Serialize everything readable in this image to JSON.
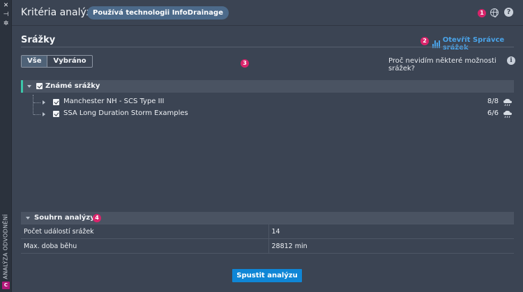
{
  "sidebar_strip": {
    "close_glyph": "✕",
    "pin_glyph": "⊣",
    "settings_glyph": "✲",
    "vertical_label": "ANALÝZA ODVODNĚNÍ",
    "logo_text": "C"
  },
  "header": {
    "title": "Kritéria analýzy",
    "tech_badge": "Používá technologii InfoDrainage",
    "help_glyph": "?"
  },
  "markers": [
    "1",
    "2",
    "3",
    "4"
  ],
  "rainfall": {
    "section_title": "Srážky",
    "open_manager_label": "Otevřít Správce srážek",
    "filter_all": "Vše",
    "filter_selected": "Vybráno",
    "why_text": "Proč nevidím některé možnosti srážek?",
    "info_glyph": "i",
    "group_label": "Známé srážky",
    "storms": [
      {
        "name": "Manchester NH - SCS Type III",
        "count": "8/8",
        "checked": true
      },
      {
        "name": "SSA Long Duration Storm Examples",
        "count": "6/6",
        "checked": true
      }
    ]
  },
  "summary": {
    "title": "Souhrn analýzy",
    "rows": [
      {
        "label": "Počet událostí srážek",
        "value": "14"
      },
      {
        "label": "Max. doba běhu",
        "value": "28812 min"
      }
    ]
  },
  "run_button_label": "Spustit analýzu",
  "colors": {
    "accent": "#0f86d6",
    "link": "#4aa3e8",
    "marker": "#d8246b",
    "group_accent": "#3cc6a9",
    "panel_bg": "#3b4453"
  }
}
